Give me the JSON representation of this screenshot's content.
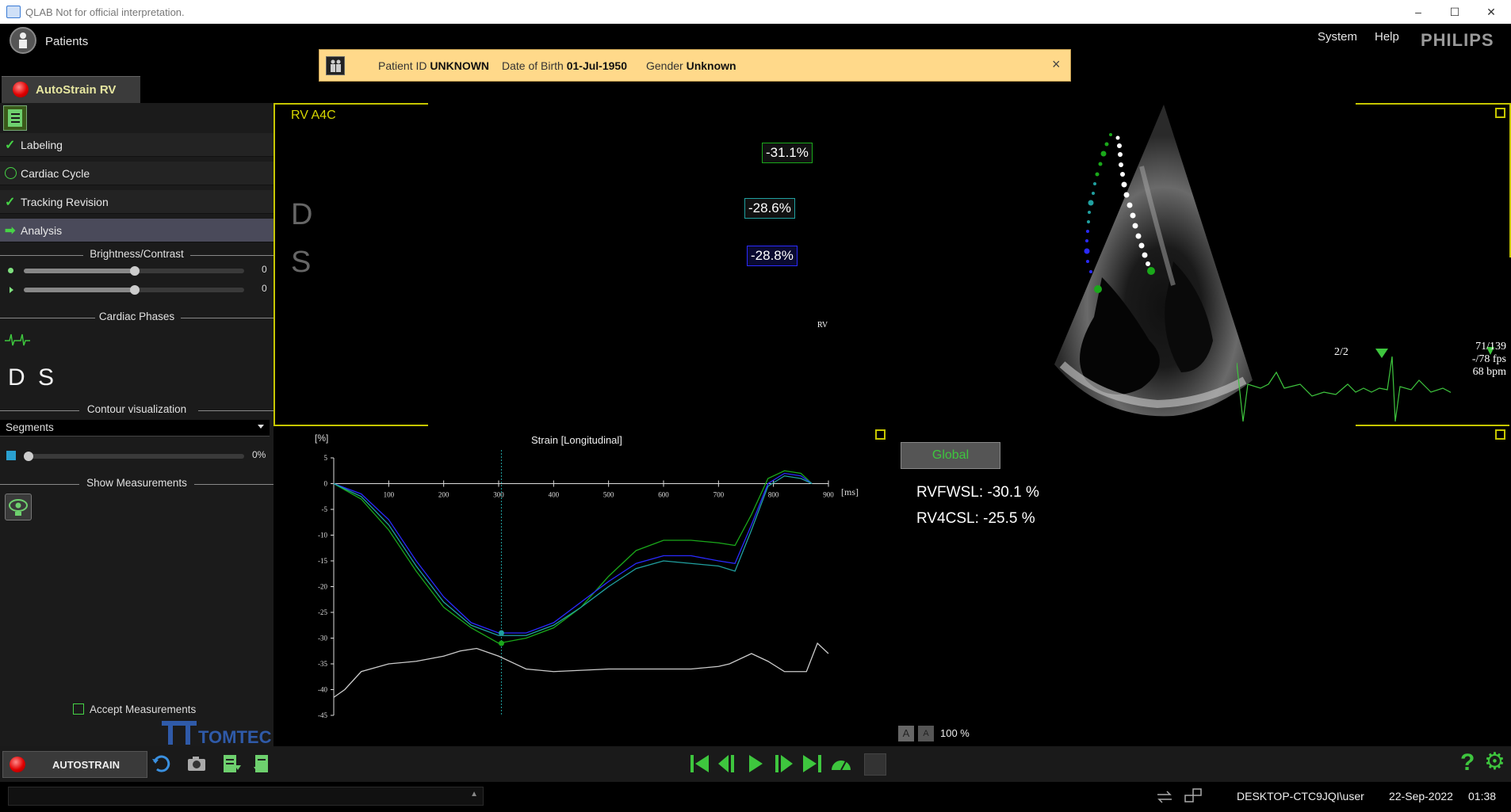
{
  "window": {
    "title": "QLAB Not for official interpretation.",
    "controls": [
      "–",
      "☐",
      "✕"
    ]
  },
  "header": {
    "patients_label": "Patients",
    "patient_bar": {
      "id_label": "Patient ID",
      "id_value": "UNKNOWN",
      "dob_label": "Date of Birth",
      "dob_value": "01-Jul-1950",
      "gender_label": "Gender",
      "gender_value": "Unknown",
      "close": "×"
    },
    "menu": [
      "System",
      "Help"
    ],
    "brand": "PHILIPS"
  },
  "tab": {
    "label": "AutoStrain RV"
  },
  "left_panel": {
    "workflow": [
      {
        "label": "Labeling",
        "state": "done"
      },
      {
        "label": "Cardiac Cycle",
        "state": "open"
      },
      {
        "label": "Tracking Revision",
        "state": "done"
      },
      {
        "label": "Analysis",
        "state": "active"
      }
    ],
    "brightness_contrast": {
      "title": "Brightness/Contrast",
      "brightness_value": "0",
      "contrast_value": "0",
      "brightness_level": 0.5,
      "contrast_level": 0.5
    },
    "cardiac_phases": {
      "title": "Cardiac Phases",
      "phases": [
        "D",
        "S"
      ]
    },
    "contour_visualization": {
      "title": "Contour visualization",
      "selected": "Segments",
      "opacity_value": "0%",
      "opacity_level": 0
    },
    "show_measurements": {
      "title": "Show Measurements"
    },
    "accept_measurements": "Accept Measurements",
    "logo": "TOMTEC"
  },
  "echo_view": {
    "view_label": "RV A4C",
    "phase_markers": [
      "D",
      "S"
    ],
    "segment_labels": [
      "-31.1%",
      "-28.6%",
      "-28.8%"
    ],
    "rv_tag": "RV",
    "ecg": {
      "beat": "2/2",
      "frame": "71/139",
      "fps": "-/78 fps",
      "bpm": "68 bpm"
    }
  },
  "strain_chart": {
    "title": "Strain [Longitudinal]",
    "y_unit": "[%]",
    "x_unit": "[ms]",
    "y_ticks": [
      "5",
      "0",
      "-5",
      "-10",
      "-15",
      "-20",
      "-25",
      "-30",
      "-35",
      "-40",
      "-45"
    ],
    "x_ticks": [
      "100",
      "200",
      "300",
      "400",
      "500",
      "600",
      "700",
      "800",
      "900"
    ]
  },
  "chart_data": {
    "type": "line",
    "title": "Strain [Longitudinal]",
    "xlabel": "[ms]",
    "ylabel": "[%]",
    "xlim": [
      0,
      900
    ],
    "ylim": [
      -45,
      5
    ],
    "marker_x": 305,
    "series": [
      {
        "color": "#1aa81a",
        "x": [
          0,
          50,
          100,
          150,
          200,
          250,
          300,
          350,
          400,
          450,
          500,
          550,
          600,
          650,
          700,
          730,
          760,
          790,
          820,
          850,
          870
        ],
        "y": [
          0,
          -3,
          -9,
          -17,
          -24,
          -28,
          -31,
          -30,
          -28,
          -24,
          -18,
          -13,
          -11,
          -11,
          -11.5,
          -12,
          -6,
          1,
          2.5,
          2,
          0
        ]
      },
      {
        "color": "#2a2aff",
        "x": [
          0,
          50,
          100,
          150,
          200,
          250,
          300,
          350,
          400,
          450,
          500,
          550,
          600,
          650,
          700,
          730,
          760,
          790,
          820,
          850,
          870
        ],
        "y": [
          0,
          -2,
          -7,
          -15,
          -22,
          -27,
          -29,
          -29,
          -27,
          -23,
          -19,
          -15.5,
          -14,
          -14,
          -15,
          -15.5,
          -8,
          0,
          2,
          1.5,
          0
        ]
      },
      {
        "color": "#20a0a0",
        "x": [
          0,
          50,
          100,
          150,
          200,
          250,
          300,
          350,
          400,
          450,
          500,
          550,
          600,
          650,
          700,
          730,
          760,
          790,
          820,
          850,
          870
        ],
        "y": [
          0,
          -2.5,
          -8,
          -16,
          -23,
          -27.5,
          -29.5,
          -29.5,
          -27.5,
          -24,
          -20,
          -16.5,
          -15,
          -15.5,
          -16,
          -17,
          -9,
          -0.5,
          1.5,
          1,
          0
        ]
      },
      {
        "color": "#cccccc",
        "x": [
          0,
          20,
          50,
          100,
          150,
          200,
          230,
          260,
          300,
          350,
          400,
          500,
          600,
          650,
          700,
          720,
          760,
          790,
          820,
          860,
          880,
          900
        ],
        "y": [
          -41.5,
          -40,
          -36.5,
          -35,
          -34.5,
          -33.5,
          -32.5,
          -32,
          -33.5,
          -36,
          -36.5,
          -36,
          -36,
          -36,
          -35.5,
          -35,
          -33,
          -34.5,
          -36.5,
          -36.5,
          -31,
          -33
        ]
      }
    ]
  },
  "results": {
    "segment_button": "Global",
    "rvfwsl": "RVFWSL: -30.1 %",
    "rv4csl": "RV4CSL: -25.5 %",
    "zoom_value": "100 %",
    "font_buttons": [
      "A",
      "A"
    ]
  },
  "toolbar": {
    "mode_label": "AUTOSTRAIN"
  },
  "status": {
    "machine": "DESKTOP-CTC9JQI\\user",
    "date": "22-Sep-2022",
    "time": "01:38"
  },
  "colors": {
    "accent_yellow": "#c6c600",
    "green": "#3ec63e",
    "patient_bar": "#ffd98a"
  }
}
